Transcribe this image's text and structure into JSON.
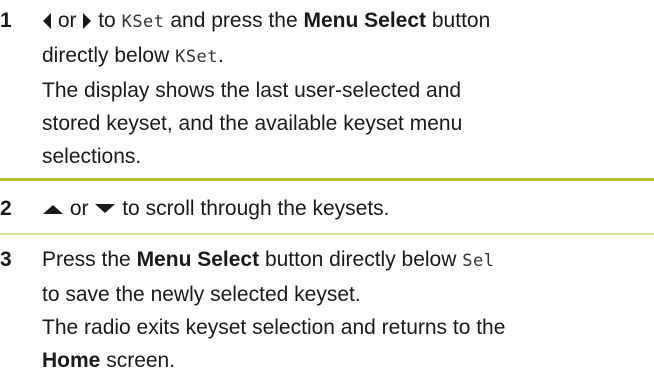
{
  "steps": [
    {
      "number": "1",
      "line1": {
        "or": "or",
        "to": "to",
        "kset": "KSet",
        "and_press_the": "and press the",
        "menu_select": "Menu Select",
        "button": "button"
      },
      "line2": {
        "directly_below": "directly below",
        "kset": "KSet",
        "period": "."
      },
      "line3": "The display shows the last user-selected and",
      "line4": "stored keyset, and the available keyset menu",
      "line5": "selections."
    },
    {
      "number": "2",
      "or": "or",
      "text": "to scroll through the keysets."
    },
    {
      "number": "3",
      "line1": {
        "press_the": "Press the",
        "menu_select": "Menu Select",
        "button_directly_below": "button directly below",
        "sel": "Sel"
      },
      "line2": "to save the newly selected keyset.",
      "line3": "The radio exits keyset selection and returns to the",
      "line4": {
        "home": "Home",
        "screen": "screen."
      }
    }
  ],
  "colors": {
    "divider": "#b8bd2c",
    "text": "#1a1a1a"
  },
  "icons": [
    "left-arrow-icon",
    "right-arrow-icon",
    "up-arrow-icon",
    "down-arrow-icon"
  ]
}
